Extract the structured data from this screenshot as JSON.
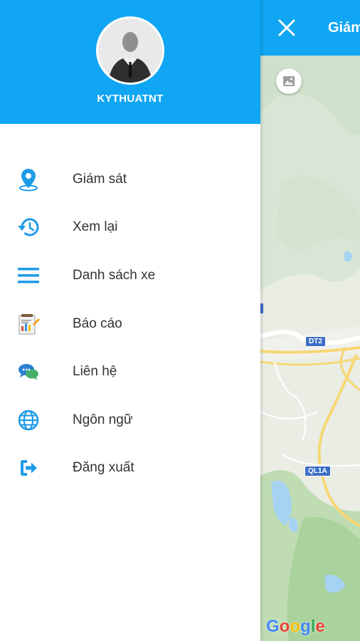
{
  "map": {
    "title": "Giám",
    "route_labels": [
      "DT2",
      "QL1A"
    ],
    "google_letters": [
      "G",
      "o",
      "o",
      "g",
      "l",
      "e"
    ]
  },
  "drawer": {
    "username": "KYTHUATNT",
    "menu": [
      {
        "label": "Giám sát",
        "icon": "location-pin-icon"
      },
      {
        "label": "Xem lại",
        "icon": "history-icon"
      },
      {
        "label": "Danh sách xe",
        "icon": "list-menu-icon"
      },
      {
        "label": "Báo cáo",
        "icon": "report-icon"
      },
      {
        "label": "Liên hệ",
        "icon": "chat-bubbles-icon"
      },
      {
        "label": "Ngôn ngữ",
        "icon": "globe-icon"
      },
      {
        "label": "Đăng xuất",
        "icon": "logout-icon"
      }
    ]
  },
  "colors": {
    "primary": "#10a6f3",
    "icon_blue": "#1e9be8",
    "text": "#333333"
  }
}
